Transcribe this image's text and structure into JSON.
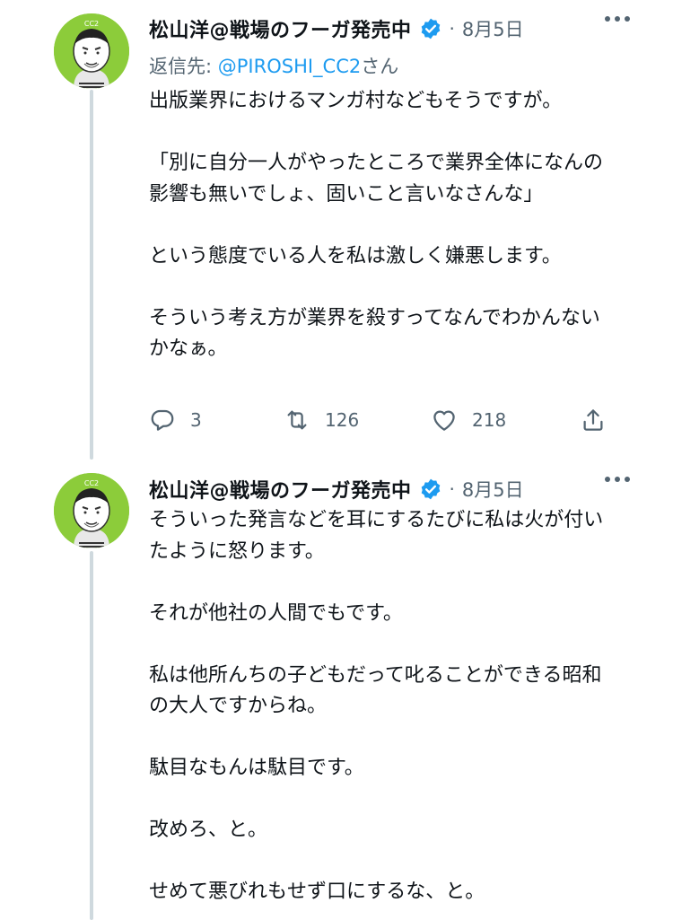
{
  "tweets": [
    {
      "author_name": "松山洋@戦場のフーガ発売中",
      "avatar_badge": "CC2",
      "separator": "·",
      "date": "8月5日",
      "reply_prefix": "返信先: ",
      "reply_handle": "@PIROSHI_CC2",
      "reply_suffix": "さん",
      "paragraphs": [
        "出版業界におけるマンガ村などもそうですが。",
        "「別に自分一人がやったところで業界全体になんの影響も無いでしょ、固いこと言いなさんな」",
        "という態度でいる人を私は激しく嫌悪します。",
        "そういう考え方が業界を殺すってなんでわかんないかなぁ。"
      ],
      "actions": {
        "reply_count": "3",
        "retweet_count": "126",
        "like_count": "218"
      }
    },
    {
      "author_name": "松山洋@戦場のフーガ発売中",
      "avatar_badge": "CC2",
      "separator": "·",
      "date": "8月5日",
      "paragraphs": [
        "そういった発言などを耳にするたびに私は火が付いたように怒ります。",
        "それが他社の人間でもです。",
        "私は他所んちの子どもだって叱ることができる昭和の大人ですからね。",
        "駄目なもんは駄目です。",
        "改めろ、と。",
        "せめて悪びれもせず口にするな、と。"
      ]
    }
  ],
  "colors": {
    "verified": "#1d9bf0",
    "handle": "#1d9bf0",
    "muted": "#536471",
    "thread_line": "#cfd9de",
    "avatar_bg": "#8ccc3a"
  },
  "icons": [
    "reply-icon",
    "retweet-icon",
    "like-icon",
    "share-icon",
    "verified-icon",
    "more-icon"
  ]
}
